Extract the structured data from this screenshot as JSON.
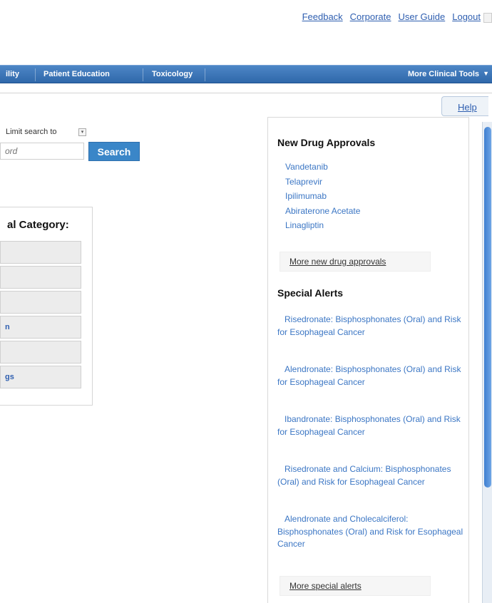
{
  "header": {
    "links": [
      "Feedback",
      "Corporate",
      "User Guide",
      "Logout"
    ]
  },
  "nav": {
    "tabs": [
      "ility",
      "Patient Education",
      "Toxicology"
    ],
    "more": "More Clinical Tools"
  },
  "help": "Help",
  "search": {
    "limit_label": "Limit search to",
    "placeholder": "ord",
    "button": "Search"
  },
  "category": {
    "title": "al Category:",
    "buttons": [
      "",
      "",
      "",
      "n",
      "",
      "gs"
    ]
  },
  "sidebar": {
    "new_drugs_heading": "New Drug Approvals",
    "new_drugs": [
      "Vandetanib",
      "Telaprevir",
      "Ipilimumab",
      "Abiraterone Acetate",
      "Linagliptin"
    ],
    "more_new_drugs": "More new drug approvals",
    "alerts_heading": "Special Alerts",
    "alerts": [
      "Risedronate: Bisphosphonates (Oral) and Risk for Esophageal Cancer",
      "Alendronate: Bisphosphonates (Oral) and Risk for Esophageal Cancer",
      "Ibandronate: Bisphosphonates (Oral) and Risk for Esophageal Cancer",
      "Risedronate and Calcium: Bisphosphonates (Oral) and Risk for Esophageal Cancer",
      "Alendronate and Cholecalciferol: Bisphosphonates (Oral) and Risk for Esophageal Cancer"
    ],
    "more_alerts": "More special alerts"
  },
  "colors": {
    "nav_blue": "#2f68aa",
    "link_blue": "#3b76c4",
    "search_button": "#3a86c8"
  }
}
